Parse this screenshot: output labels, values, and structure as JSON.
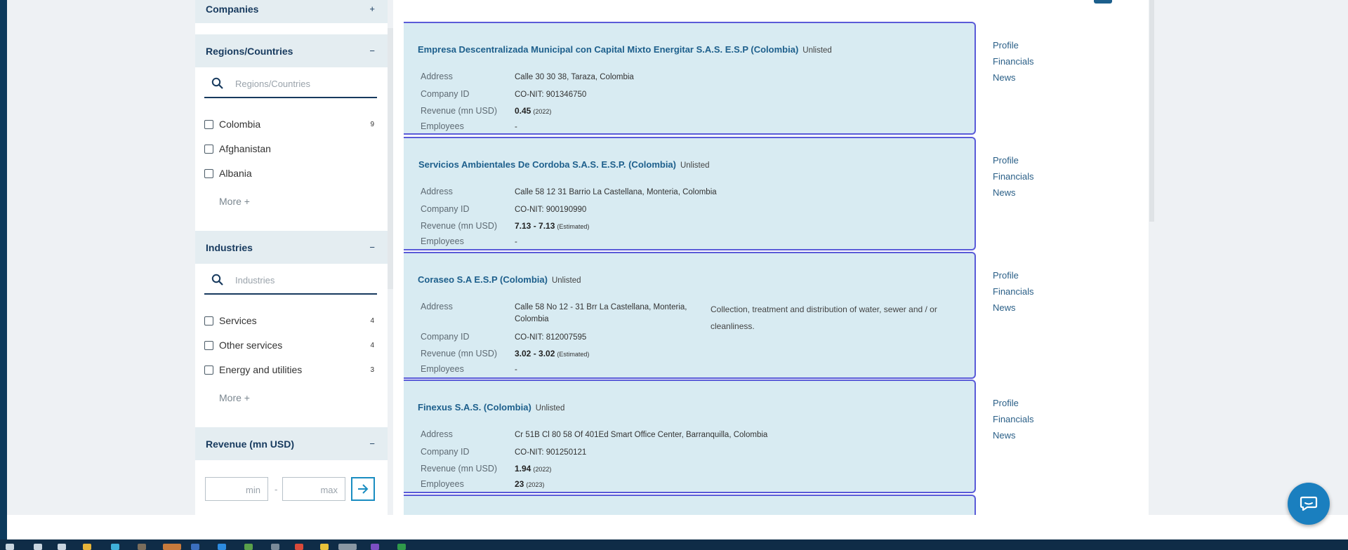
{
  "sidebar": {
    "companies": {
      "title": "Companies",
      "toggle": "+"
    },
    "regions": {
      "title": "Regions/Countries",
      "toggle": "−",
      "search_placeholder": "Regions/Countries",
      "items": [
        {
          "label": "Colombia",
          "count": "9"
        },
        {
          "label": "Afghanistan",
          "count": ""
        },
        {
          "label": "Albania",
          "count": ""
        }
      ],
      "more": "More +"
    },
    "industries": {
      "title": "Industries",
      "toggle": "−",
      "search_placeholder": "Industries",
      "items": [
        {
          "label": "Services",
          "count": "4"
        },
        {
          "label": "Other services",
          "count": "4"
        },
        {
          "label": "Energy and utilities",
          "count": "3"
        }
      ],
      "more": "More +"
    },
    "revenue": {
      "title": "Revenue (mn USD)",
      "toggle": "−",
      "min_placeholder": "min",
      "max_placeholder": "max",
      "dash": "-"
    }
  },
  "labels": {
    "address": "Address",
    "company_id": "Company ID",
    "revenue": "Revenue (mn USD)",
    "employees": "Employees"
  },
  "links": {
    "profile": "Profile",
    "financials": "Financials",
    "news": "News"
  },
  "results": [
    {
      "name": "Empresa Descentralizada Municipal con Capital Mixto Energitar S.A.S. E.S.P (Colombia)",
      "status": "Unlisted",
      "address": "Calle 30 30 38, Taraza, Colombia",
      "company_id": "CO-NIT: 901346750",
      "revenue": "0.45",
      "revenue_note": "(2022)",
      "employees": "-",
      "employees_note": ""
    },
    {
      "name": "Servicios Ambientales De Cordoba S.A.S. E.S.P. (Colombia)",
      "status": "Unlisted",
      "address": "Calle 58 12 31 Barrio La Castellana, Monteria, Colombia",
      "company_id": "CO-NIT: 900190990",
      "revenue": "7.13 - 7.13",
      "revenue_note": "(Estimated)",
      "employees": "-",
      "employees_note": ""
    },
    {
      "name": "Coraseo S.A E.S.P (Colombia)",
      "status": "Unlisted",
      "address_line1": "Calle 58 No 12 - 31 Brr La Castellana, Monteria,",
      "address_line2": "Colombia",
      "description_line1": "Collection, treatment and distribution of water, sewer and / or",
      "description_line2": "cleanliness.",
      "company_id": "CO-NIT: 812007595",
      "revenue": "3.02 - 3.02",
      "revenue_note": "(Estimated)",
      "employees": "-",
      "employees_note": ""
    },
    {
      "name": "Finexus S.A.S. (Colombia)",
      "status": "Unlisted",
      "address": "Cr 51B Cl 80 58 Of 401Ed Smart Office Center, Barranquilla, Colombia",
      "company_id": "CO-NIT: 901250121",
      "revenue": "1.94",
      "revenue_note": "(2022)",
      "employees": "23",
      "employees_note": "(2023)"
    }
  ],
  "colors": {
    "accent": "#1d5f8c",
    "card_bg": "#d8ebf2",
    "card_border": "#5a5bd8",
    "chat": "#1a7fbf"
  }
}
